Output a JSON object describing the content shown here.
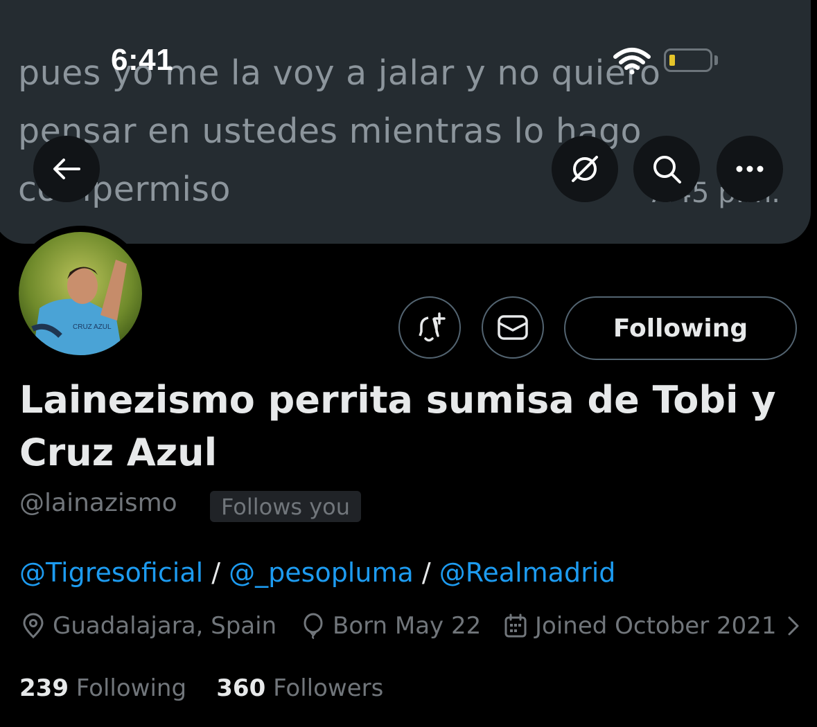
{
  "status_bar": {
    "time": "6:41"
  },
  "banner": {
    "lines": [
      "pues yo me la voy a jalar y no quiero",
      "pensar en ustedes mientras lo hago",
      "compermiso"
    ],
    "timestamp": "7:45 p.m."
  },
  "header": {
    "back_icon": "arrow-left-icon",
    "grok_icon": "grok-icon",
    "search_icon": "search-icon",
    "more_icon": "more-icon"
  },
  "actions": {
    "notify_icon": "bell-plus-icon",
    "message_icon": "envelope-icon",
    "following_label": "Following"
  },
  "profile": {
    "name": "Lainezismo perrita sumisa de Tobi y Cruz Azul",
    "handle": "@lainazismo",
    "follows_you": "Follows you",
    "bio": {
      "mention1": "@Tigresoficial",
      "sep1": " / ",
      "mention2": "@_pesopluma",
      "sep2": " / ",
      "mention3": "@Realmadrid"
    },
    "location": "Guadalajara, Spain",
    "birthday": "Born May 22",
    "joined": "Joined October 2021"
  },
  "stats": {
    "following_count": "239",
    "following_label": "Following",
    "followers_count": "360",
    "followers_label": "Followers"
  },
  "colors": {
    "accent": "#1d9bf0",
    "muted": "#71767b",
    "text": "#e7e9ea",
    "background": "#000000"
  }
}
